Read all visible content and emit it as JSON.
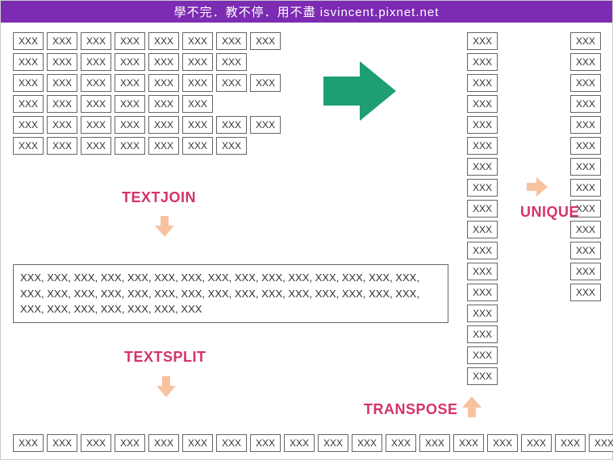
{
  "header": "學不完．教不停．用不盡 isvincent.pixnet.net",
  "cell_value": "XXX",
  "grid_rows": [
    8,
    7,
    8,
    6,
    8,
    7
  ],
  "column1_count": 17,
  "column2_count": 13,
  "bottom_count": 18,
  "joined_text": "XXX, XXX, XXX, XXX, XXX, XXX, XXX, XXX, XXX, XXX, XXX, XXX, XXX, XXX, XXX, XXX, XXX, XXX, XXX, XXX, XXX, XXX, XXX, XXX, XXX, XXX, XXX, XXX, XXX, XXX, XXX, XXX, XXX, XXX, XXX, XXX, XXX",
  "labels": {
    "textjoin": "TEXTJOIN",
    "textsplit": "TEXTSPLIT",
    "transpose": "TRANSPOSE",
    "unique": "UNIQUE"
  },
  "colors": {
    "header_bg": "#7c2bb3",
    "label": "#d6336c",
    "big_arrow": "#1d9e73",
    "small_arrow": "#f8c2a0"
  }
}
